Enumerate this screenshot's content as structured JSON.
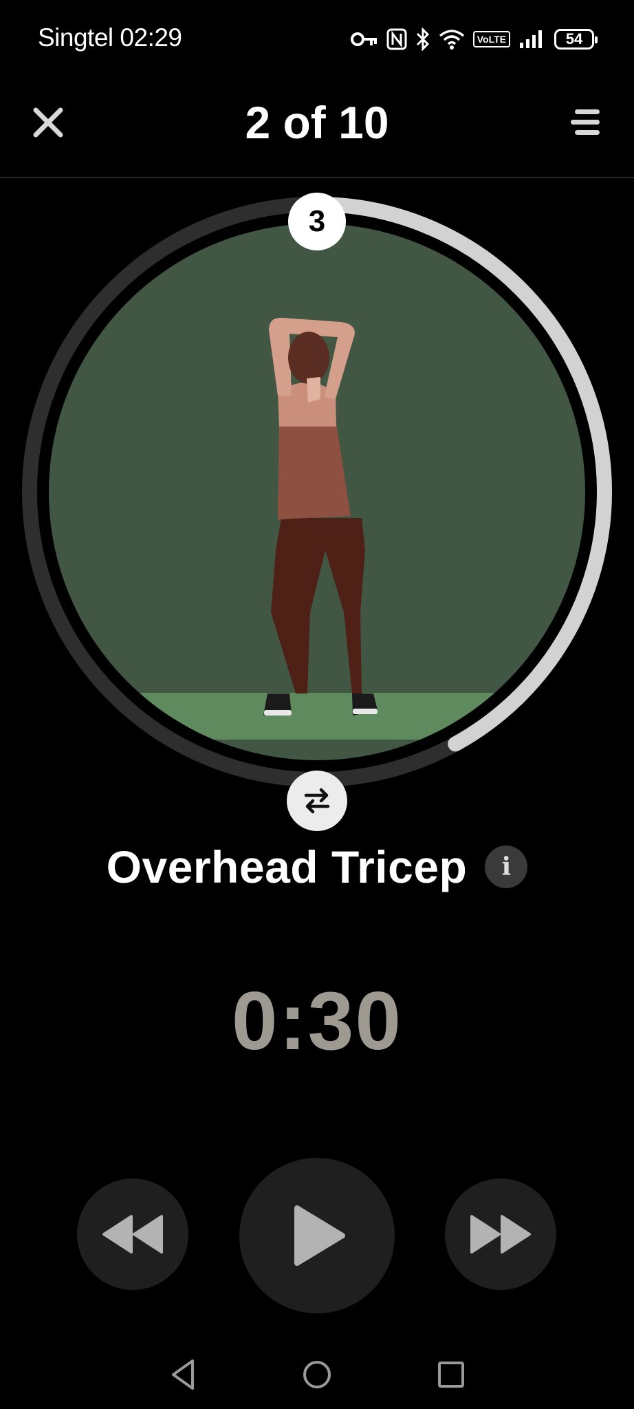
{
  "status_bar": {
    "carrier": "Singtel",
    "time": "02:29",
    "volte": "VoLTE",
    "battery": "54"
  },
  "header": {
    "progress": "2 of 10"
  },
  "exercise": {
    "count": "3",
    "name": "Overhead Tricep",
    "info_glyph": "i",
    "ring_progress_fraction": 0.42
  },
  "timer": {
    "value": "0:30"
  },
  "colors": {
    "background": "#000000",
    "ring_track": "#2e2e2e",
    "ring_progress": "#d2d2d2",
    "scene_background": "#425743",
    "floor": "#5f8a5d",
    "timer_text": "#9e9a92",
    "control_bg": "#1f1f1f",
    "control_icon": "#b3b3b3"
  },
  "icons": {
    "close": "close-icon",
    "menu": "menu-icon",
    "swap": "swap-icon",
    "info": "info-icon",
    "rewind": "rewind-icon",
    "play": "play-icon",
    "fast_forward": "fast-forward-icon",
    "nav_back": "nav-back-icon",
    "nav_home": "nav-home-icon",
    "nav_recents": "nav-recents-icon"
  }
}
